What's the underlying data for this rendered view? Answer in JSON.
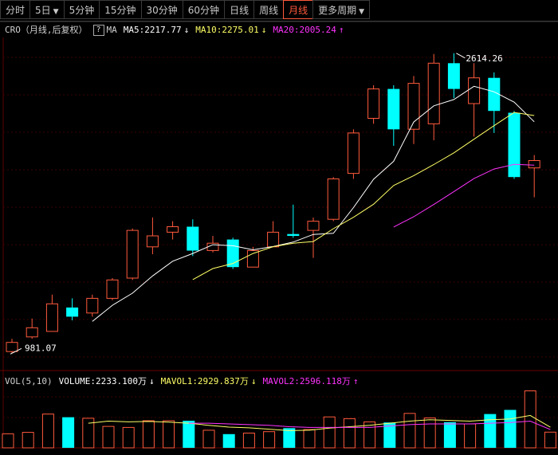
{
  "tabs": [
    {
      "label": "分时",
      "active": false,
      "dropdown": false
    },
    {
      "label": "5日",
      "active": false,
      "dropdown": true
    },
    {
      "label": "5分钟",
      "active": false,
      "dropdown": false
    },
    {
      "label": "15分钟",
      "active": false,
      "dropdown": false
    },
    {
      "label": "30分钟",
      "active": false,
      "dropdown": false
    },
    {
      "label": "60分钟",
      "active": false,
      "dropdown": false
    },
    {
      "label": "日线",
      "active": false,
      "dropdown": false
    },
    {
      "label": "周线",
      "active": false,
      "dropdown": false
    },
    {
      "label": "月线",
      "active": true,
      "dropdown": false
    },
    {
      "label": "更多周期",
      "active": false,
      "dropdown": true
    }
  ],
  "price_legend": {
    "name": "CRO（月线,后复权）",
    "help": "?",
    "ma_label": "MA",
    "ma5": "MA5:2217.77",
    "ma5_arrow": "↓",
    "ma10": "MA10:2275.01",
    "ma10_arrow": "↓",
    "ma20": "MA20:2005.24",
    "ma20_arrow": "↑"
  },
  "volume_legend": {
    "name": "VOL(5,10)",
    "volume": "VOLUME:2233.100万",
    "volume_arrow": "↓",
    "mavol1": "MAVOL1:2929.837万",
    "mavol1_arrow": "↓",
    "mavol2": "MAVOL2:2596.118万",
    "mavol2_arrow": "↑"
  },
  "colors": {
    "up": "#ff5a3c",
    "down": "#00ffff",
    "ma5": "#ffffff",
    "ma10": "#ffff66",
    "ma20": "#ff33ff",
    "background": "#000000",
    "grid": "#3a0000"
  },
  "chart_data": [
    {
      "type": "candlestick",
      "title": "CRO（月线,后复权）",
      "ylim": [
        900,
        2700
      ],
      "annotations": {
        "high": "2614.26",
        "low": "981.07"
      },
      "candles": [
        {
          "o": 990,
          "c": 1040,
          "h": 1060,
          "l": 981.07
        },
        {
          "o": 1070,
          "c": 1120,
          "h": 1170,
          "l": 1060
        },
        {
          "o": 1100,
          "c": 1250,
          "h": 1300,
          "l": 1100
        },
        {
          "o": 1230,
          "c": 1180,
          "h": 1280,
          "l": 1160
        },
        {
          "o": 1200,
          "c": 1280,
          "h": 1300,
          "l": 1180
        },
        {
          "o": 1280,
          "c": 1380,
          "h": 1390,
          "l": 1270
        },
        {
          "o": 1390,
          "c": 1650,
          "h": 1660,
          "l": 1380
        },
        {
          "o": 1560,
          "c": 1620,
          "h": 1720,
          "l": 1520
        },
        {
          "o": 1640,
          "c": 1670,
          "h": 1700,
          "l": 1600
        },
        {
          "o": 1670,
          "c": 1540,
          "h": 1710,
          "l": 1510
        },
        {
          "o": 1540,
          "c": 1580,
          "h": 1620,
          "l": 1530
        },
        {
          "o": 1600,
          "c": 1450,
          "h": 1610,
          "l": 1440
        },
        {
          "o": 1450,
          "c": 1540,
          "h": 1560,
          "l": 1450
        },
        {
          "o": 1560,
          "c": 1640,
          "h": 1700,
          "l": 1560
        },
        {
          "o": 1630,
          "c": 1620,
          "h": 1790,
          "l": 1610
        },
        {
          "o": 1650,
          "c": 1700,
          "h": 1720,
          "l": 1500
        },
        {
          "o": 1710,
          "c": 1930,
          "h": 1940,
          "l": 1700
        },
        {
          "o": 1960,
          "c": 2180,
          "h": 2200,
          "l": 1930
        },
        {
          "o": 2260,
          "c": 2420,
          "h": 2440,
          "l": 2230
        },
        {
          "o": 2420,
          "c": 2200,
          "h": 2440,
          "l": 2110
        },
        {
          "o": 2200,
          "c": 2450,
          "h": 2490,
          "l": 2120
        },
        {
          "o": 2230,
          "c": 2560,
          "h": 2610,
          "l": 2140
        },
        {
          "o": 2560,
          "c": 2420,
          "h": 2614.26,
          "l": 2370
        },
        {
          "o": 2340,
          "c": 2480,
          "h": 2560,
          "l": 2160
        },
        {
          "o": 2480,
          "c": 2300,
          "h": 2510,
          "l": 2180
        },
        {
          "o": 2290,
          "c": 1940,
          "h": 2300,
          "l": 1930
        },
        {
          "o": 1990,
          "c": 2030,
          "h": 2060,
          "l": 1830
        }
      ],
      "ma5": [
        null,
        null,
        null,
        null,
        1154,
        1242,
        1308,
        1402,
        1482,
        1524,
        1572,
        1566,
        1544,
        1562,
        1586,
        1628,
        1634,
        1774,
        1928,
        2026,
        2240,
        2328,
        2362,
        2434,
        2404,
        2348,
        2241
      ],
      "ma10": [
        null,
        null,
        null,
        null,
        null,
        null,
        null,
        null,
        null,
        1382,
        1442,
        1470,
        1524,
        1561,
        1580,
        1589,
        1659,
        1721,
        1792,
        1894,
        1948,
        2008,
        2072,
        2146,
        2220,
        2292,
        2275
      ],
      "ma20": [
        null,
        null,
        null,
        null,
        null,
        null,
        null,
        null,
        null,
        null,
        null,
        null,
        null,
        null,
        null,
        null,
        null,
        null,
        null,
        1668,
        1724,
        1791,
        1861,
        1932,
        1984,
        2009,
        2005
      ]
    },
    {
      "type": "bar",
      "title": "VOL(5,10)",
      "unit": "万",
      "ylim": [
        0,
        8500
      ],
      "values": [
        2000,
        2200,
        4800,
        4350,
        4200,
        3050,
        2900,
        3850,
        3850,
        3850,
        2500,
        1950,
        2100,
        2300,
        2800,
        2600,
        4400,
        4150,
        3700,
        3600,
        4900,
        4250,
        3650,
        3400,
        4800,
        5400,
        8100,
        2233.1
      ],
      "mavol1": [
        null,
        null,
        null,
        null,
        3500,
        3800,
        3700,
        3750,
        3650,
        3500,
        3200,
        2950,
        2850,
        2650,
        2450,
        2500,
        2800,
        3000,
        3200,
        3500,
        3800,
        4000,
        3900,
        3800,
        4000,
        4100,
        4600,
        2929.837
      ],
      "mavol2": [
        null,
        null,
        null,
        null,
        null,
        null,
        null,
        null,
        null,
        3500,
        3500,
        3400,
        3300,
        3200,
        3000,
        2900,
        2900,
        2900,
        2900,
        3100,
        3300,
        3400,
        3400,
        3400,
        3500,
        3600,
        3800,
        2596.118
      ]
    }
  ]
}
